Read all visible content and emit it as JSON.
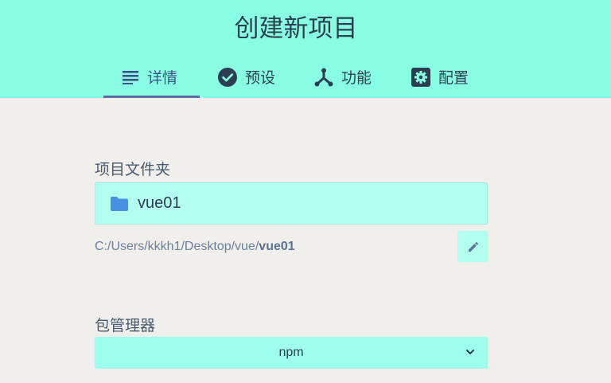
{
  "header": {
    "title": "创建新项目",
    "background": "#88ffe2",
    "tabs": [
      {
        "label": "详情",
        "icon": "subject-icon",
        "active": true
      },
      {
        "label": "预设",
        "icon": "check-circle-icon",
        "active": false
      },
      {
        "label": "功能",
        "icon": "call-split-icon",
        "active": false
      },
      {
        "label": "配置",
        "icon": "settings-applications-icon",
        "active": false
      }
    ]
  },
  "project_folder": {
    "label": "项目文件夹",
    "value": "vue01",
    "path_prefix": "C:/Users/kkkh1/Desktop/vue/",
    "path_name": "vue01",
    "edit_icon": "pencil-icon"
  },
  "package_manager": {
    "label": "包管理器",
    "selected": "npm",
    "icon": "chevron-down-icon"
  },
  "colors": {
    "page_background": "#f1efeb",
    "input_background": "#b3fff0",
    "select_background": "#9effee",
    "folder_icon": "#4a90e2",
    "text": "#2c3e50"
  }
}
